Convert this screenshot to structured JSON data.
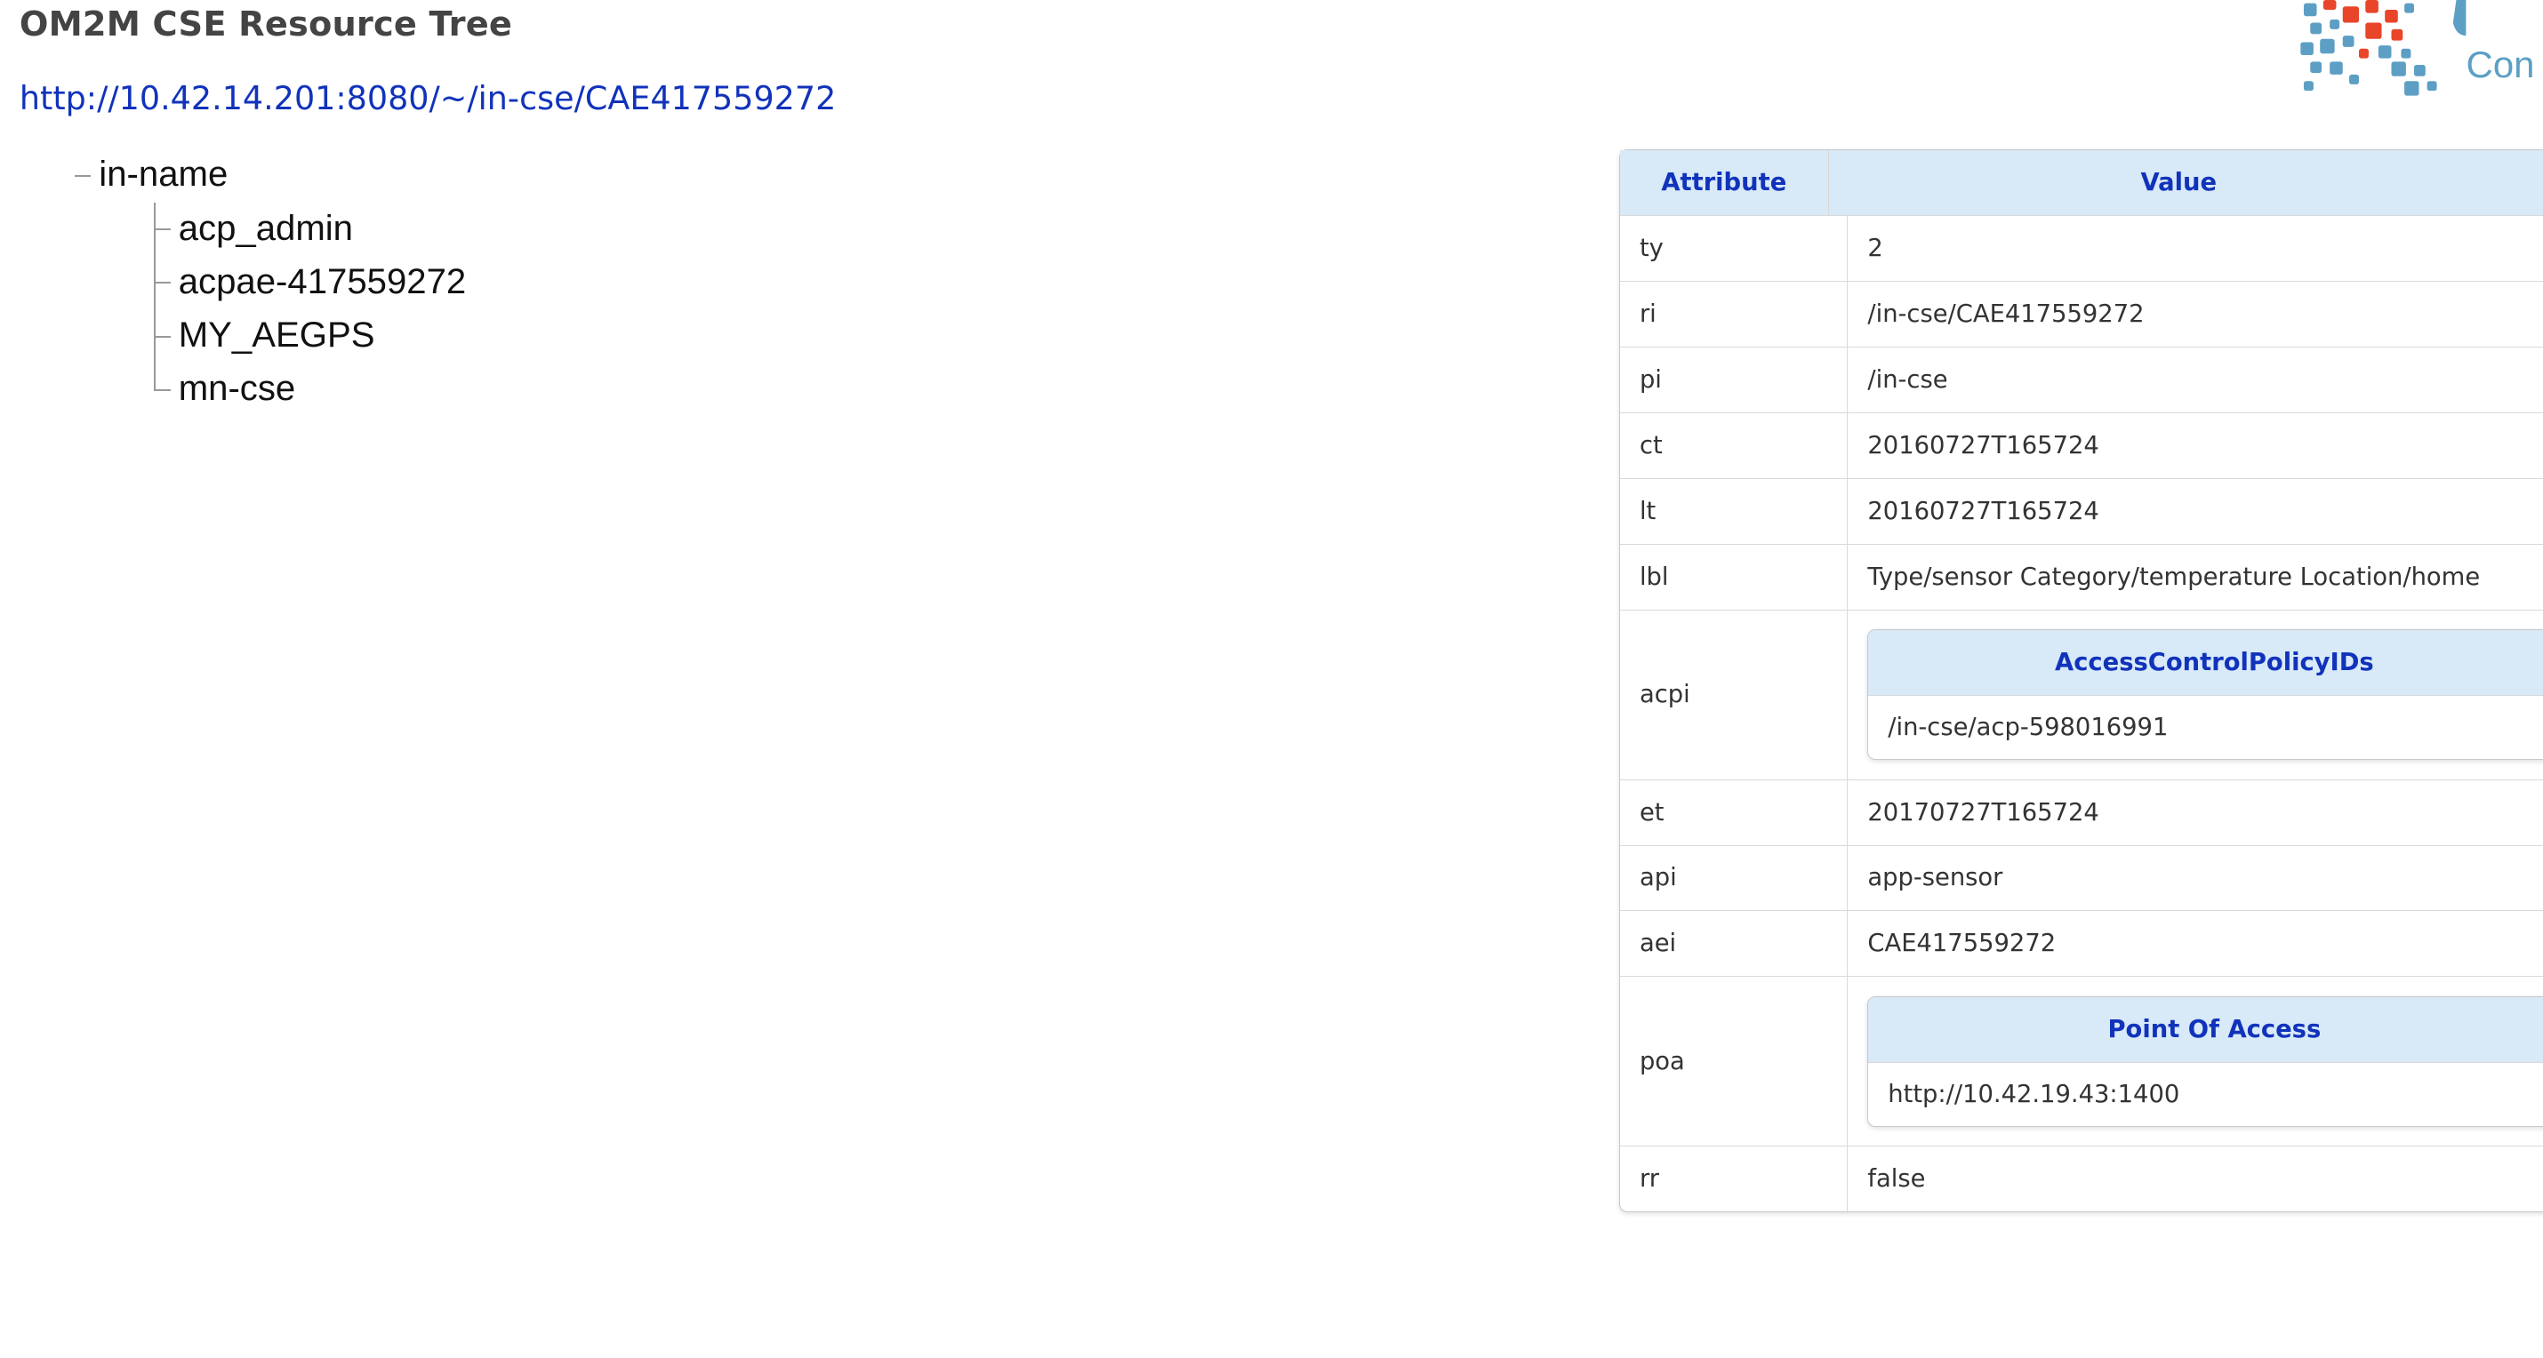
{
  "header": {
    "title": "OM2M CSE Resource Tree",
    "url": "http://10.42.14.201:8080/~/in-cse/CAE417559272",
    "logo_text": "Con"
  },
  "tree": {
    "root": "in-name",
    "children": [
      "acp_admin",
      "acpae-417559272",
      "MY_AEGPS",
      "mn-cse"
    ]
  },
  "table": {
    "header_attribute": "Attribute",
    "header_value": "Value",
    "rows": [
      {
        "name": "ty",
        "value": "2"
      },
      {
        "name": "ri",
        "value": "/in-cse/CAE417559272"
      },
      {
        "name": "pi",
        "value": "/in-cse"
      },
      {
        "name": "ct",
        "value": "20160727T165724"
      },
      {
        "name": "lt",
        "value": "20160727T165724"
      },
      {
        "name": "lbl",
        "value": "Type/sensor Category/temperature Location/home"
      },
      {
        "name": "acpi",
        "nested_header": "AccessControlPolicyIDs",
        "nested_value": "/in-cse/acp-598016991"
      },
      {
        "name": "et",
        "value": "20170727T165724"
      },
      {
        "name": "api",
        "value": "app-sensor"
      },
      {
        "name": "aei",
        "value": "CAE417559272"
      },
      {
        "name": "poa",
        "nested_header": "Point Of Access",
        "nested_value": "http://10.42.19.43:1400"
      },
      {
        "name": "rr",
        "value": "false"
      }
    ]
  },
  "colors": {
    "link": "#1133bb",
    "header_bg": "#d8e9f8",
    "logo_red": "#e8452a",
    "logo_blue": "#5d9fc4"
  }
}
